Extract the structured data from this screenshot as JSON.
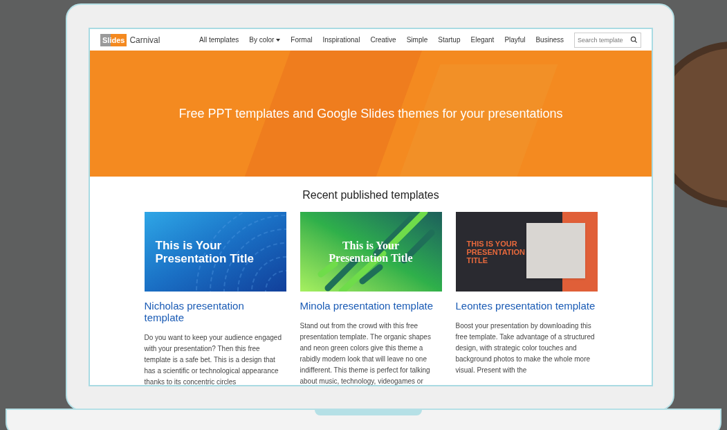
{
  "logo": {
    "badge": "Slides",
    "name": "Carnival"
  },
  "nav": [
    {
      "label": "All templates",
      "dropdown": false
    },
    {
      "label": "By color",
      "dropdown": true
    },
    {
      "label": "Formal",
      "dropdown": false
    },
    {
      "label": "Inspirational",
      "dropdown": false
    },
    {
      "label": "Creative",
      "dropdown": false
    },
    {
      "label": "Simple",
      "dropdown": false
    },
    {
      "label": "Startup",
      "dropdown": false
    },
    {
      "label": "Elegant",
      "dropdown": false
    },
    {
      "label": "Playful",
      "dropdown": false
    },
    {
      "label": "Business",
      "dropdown": false
    }
  ],
  "search": {
    "placeholder": "Search template"
  },
  "hero": {
    "title": "Free PPT templates and Google Slides themes for your presentations"
  },
  "section_title": "Recent published templates",
  "templates": [
    {
      "kind": "blue",
      "slide_title": "This is Your Presentation Title",
      "title": "Nicholas presentation template",
      "description": "Do you want to keep your audience engaged with your presentation? Then this free template is a safe bet. This is a design that has a scientific or technological appearance thanks to its concentric circles"
    },
    {
      "kind": "green",
      "slide_title": "This is Your Presentation Title",
      "title": "Minola presentation template",
      "description": "Stand out from the crowd with this free presentation template. The organic shapes and neon green colors give this theme a rabidly modern look that will leave no one indifferent. This theme is perfect for talking about music, technology, videogames or"
    },
    {
      "kind": "photo",
      "slide_title": "THIS IS YOUR PRESENTATION TITLE",
      "title": "Leontes presentation template",
      "description": "Boost your presentation by downloading this free template. Take advantage of a structured design, with strategic color touches and background photos to make the whole more visual. Present with the"
    }
  ]
}
